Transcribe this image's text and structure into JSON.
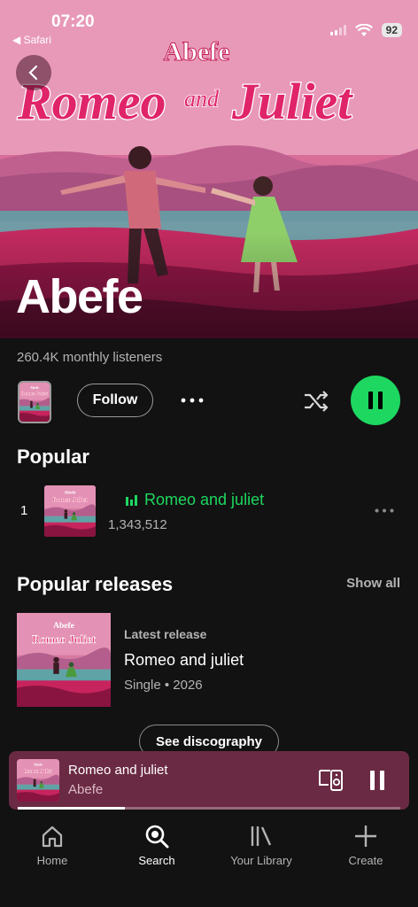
{
  "status_bar": {
    "time": "07:20",
    "back_app": "◀ Safari",
    "battery": "92"
  },
  "hero": {
    "cover_art_artist": "Abefe",
    "cover_art_title_left": "Romeo",
    "cover_art_title_mid": "and",
    "cover_art_title_right": "Juliet",
    "artist_name": "Abefe"
  },
  "info": {
    "monthly_listeners": "260.4K monthly listeners"
  },
  "controls": {
    "follow_label": "Follow",
    "more_icon": "more-horizontal-icon",
    "shuffle_icon": "shuffle-icon",
    "play_state": "playing"
  },
  "popular": {
    "title": "Popular",
    "tracks": [
      {
        "rank": "1",
        "title": "Romeo and juliet",
        "plays": "1,343,512",
        "now_playing": true
      }
    ]
  },
  "popular_releases": {
    "title": "Popular releases",
    "show_all_label": "Show all",
    "items": [
      {
        "kicker": "Latest release",
        "title": "Romeo and juliet",
        "meta": "Single • 2026"
      }
    ],
    "discography_label": "See discography"
  },
  "mini_player": {
    "title": "Romeo and juliet",
    "artist": "Abefe",
    "progress": 0.28,
    "bg_color": "#6b2a43"
  },
  "tabbar": {
    "tabs": [
      {
        "label": "Home",
        "icon": "home-icon",
        "active": false
      },
      {
        "label": "Search",
        "icon": "search-icon",
        "active": true
      },
      {
        "label": "Your Library",
        "icon": "library-icon",
        "active": false
      },
      {
        "label": "Create",
        "icon": "plus-icon",
        "active": false
      }
    ]
  },
  "colors": {
    "accent": "#1ed760",
    "background": "#121212",
    "secondary_text": "#b3b3b3"
  }
}
